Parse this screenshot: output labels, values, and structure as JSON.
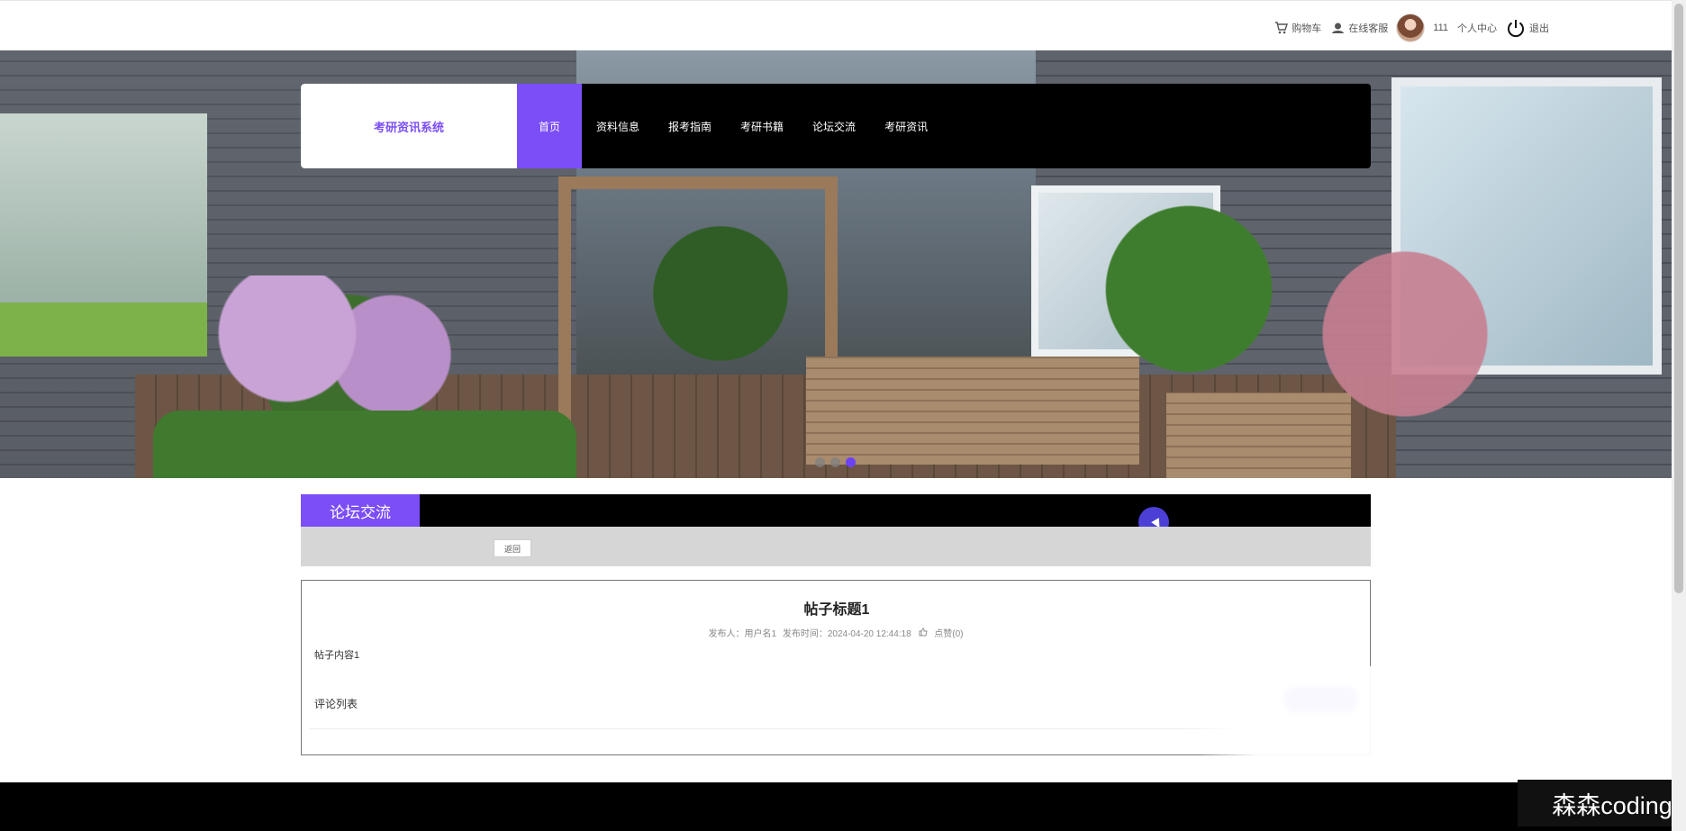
{
  "topbar": {
    "cart_label": "购物车",
    "service_label": "在线客服",
    "username": "111",
    "profile_label": "个人中心",
    "logout_label": "退出"
  },
  "nav": {
    "brand": "考研资讯系统",
    "items": [
      {
        "label": "首页"
      },
      {
        "label": "资料信息"
      },
      {
        "label": "报考指南"
      },
      {
        "label": "考研书籍"
      },
      {
        "label": "论坛交流"
      },
      {
        "label": "考研资讯"
      }
    ],
    "active_color": "#7b4ef8"
  },
  "carousel": {
    "slide_count": 3,
    "active_index": 2
  },
  "section": {
    "title": "论坛交流",
    "back_label": "返回"
  },
  "post": {
    "title": "帖子标题1",
    "author_label": "发布人：用户名1",
    "time_label": "发布时间：2024-04-20 12:44:18",
    "like_label": "点赞(0)",
    "content": "帖子内容1",
    "comments_label": "评论列表"
  },
  "watermark": "森森coding"
}
